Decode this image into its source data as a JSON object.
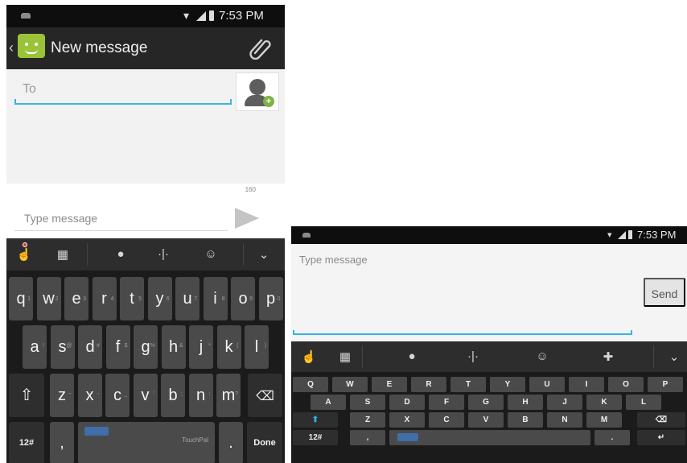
{
  "left_screen": {
    "status_bar": {
      "time": "7:53 PM"
    },
    "action_bar": {
      "title": "New message"
    },
    "to_field": {
      "placeholder": "To"
    },
    "char_counter": "160",
    "compose": {
      "placeholder": "Type message"
    },
    "keyboard": {
      "row1": [
        {
          "l": "q",
          "h": "1"
        },
        {
          "l": "w",
          "h": "2"
        },
        {
          "l": "e",
          "h": "3"
        },
        {
          "l": "r",
          "h": "4"
        },
        {
          "l": "t",
          "h": "5"
        },
        {
          "l": "y",
          "h": "6"
        },
        {
          "l": "u",
          "h": "7"
        },
        {
          "l": "i",
          "h": "8"
        },
        {
          "l": "o",
          "h": "9"
        },
        {
          "l": "p",
          "h": "0"
        }
      ],
      "row2": [
        {
          "l": "a",
          "b": "!"
        },
        {
          "l": "s",
          "b": "@"
        },
        {
          "l": "d",
          "b": "#"
        },
        {
          "l": "f",
          "b": "$"
        },
        {
          "l": "g",
          "b": "%"
        },
        {
          "l": "h",
          "b": "&"
        },
        {
          "l": "j",
          "b": "*"
        },
        {
          "l": "k",
          "b": "("
        },
        {
          "l": "l",
          "b": ")"
        }
      ],
      "row3": [
        {
          "l": "z",
          "b": "~"
        },
        {
          "l": "x",
          "b": "-"
        },
        {
          "l": "c",
          "b": "_"
        },
        {
          "l": "v",
          "b": "'"
        },
        {
          "l": "b",
          "b": ";"
        },
        {
          "l": "n",
          "b": ":"
        },
        {
          "l": "m",
          "b": "?"
        }
      ],
      "mode_key": "12#",
      "comma_key": ",",
      "period_key": ".",
      "done_key": "Done",
      "space_brand": "TouchPal"
    }
  },
  "right_screen": {
    "status_bar": {
      "time": "7:53 PM"
    },
    "compose": {
      "placeholder": "Type message"
    },
    "send_button": "Send",
    "keyboard": {
      "row1": [
        "Q",
        "W",
        "E",
        "R",
        "T",
        "Y",
        "U",
        "I",
        "O",
        "P"
      ],
      "row2": [
        "A",
        "S",
        "D",
        "F",
        "G",
        "H",
        "J",
        "K",
        "L"
      ],
      "row3": [
        "Z",
        "X",
        "C",
        "V",
        "B",
        "N",
        "M"
      ],
      "mode_key": "12#",
      "comma_key": ",",
      "period_key": "."
    }
  },
  "colors": {
    "accent": "#33b5e5",
    "app_icon": "#9bc33a",
    "status_bar": "#0e0e0e",
    "key": "#4a4a4a"
  }
}
